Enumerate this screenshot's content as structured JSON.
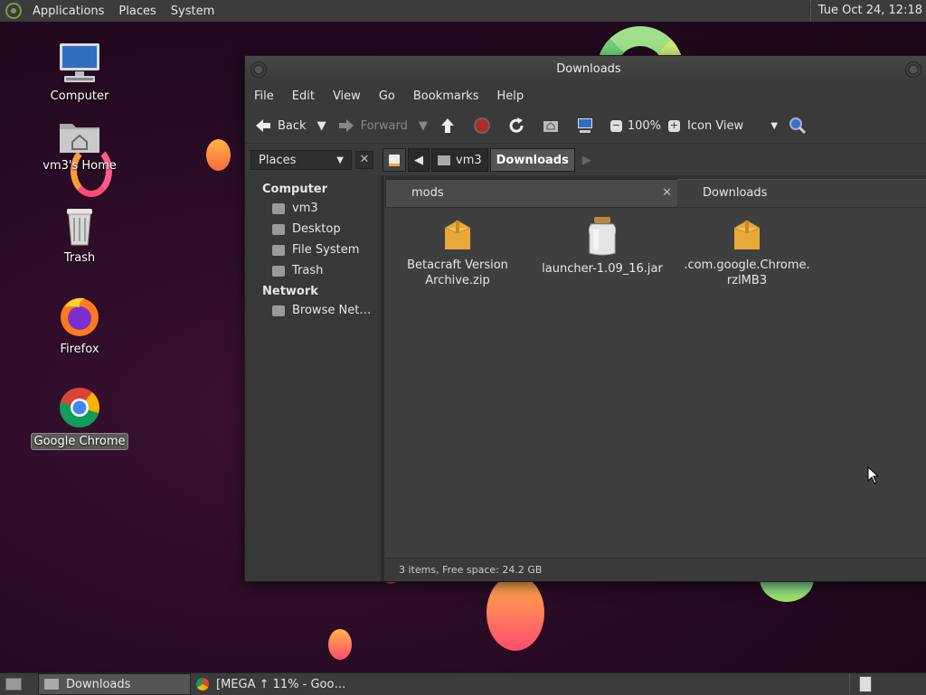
{
  "top_panel": {
    "menus": [
      "Applications",
      "Places",
      "System"
    ],
    "clock": "Tue Oct 24, 12:18"
  },
  "desktop": {
    "icons": [
      {
        "label": "Computer",
        "icon": "computer-icon"
      },
      {
        "label": "vm3's Home",
        "icon": "home-folder-icon"
      },
      {
        "label": "Trash",
        "icon": "trash-icon"
      },
      {
        "label": "Firefox",
        "icon": "firefox-icon"
      },
      {
        "label": "Google Chrome",
        "icon": "chrome-icon",
        "selected": true
      }
    ]
  },
  "window": {
    "title": "Downloads",
    "menubar": [
      "File",
      "Edit",
      "View",
      "Go",
      "Bookmarks",
      "Help"
    ],
    "toolbar": {
      "back": "Back",
      "forward": "Forward",
      "zoom": "100%",
      "view_mode": "Icon View"
    },
    "location": {
      "places_label": "Places",
      "breadcrumbs": [
        "vm3",
        "Downloads"
      ]
    },
    "sidebar": {
      "sections": [
        {
          "heading": "Computer",
          "items": [
            "vm3",
            "Desktop",
            "File System",
            "Trash"
          ]
        },
        {
          "heading": "Network",
          "items": [
            "Browse Net…"
          ]
        }
      ]
    },
    "tabs": [
      {
        "label": "mods",
        "active": false
      },
      {
        "label": "Downloads",
        "active": true
      }
    ],
    "files": [
      {
        "name_line1": "Betacraft Version",
        "name_line2": "Archive.zip",
        "icon": "archive-icon"
      },
      {
        "name_line1": "launcher-1.09_16.jar",
        "name_line2": "",
        "icon": "jar-icon"
      },
      {
        "name_line1": ".com.google.Chrome.",
        "name_line2": "rzlMB3",
        "icon": "archive-icon"
      }
    ],
    "status": "3 items, Free space: 24.2 GB"
  },
  "taskbar": {
    "tasks": [
      {
        "label": "Downloads",
        "active": true
      },
      {
        "label": "[MEGA ↑ 11% - Goo…",
        "active": false
      }
    ]
  },
  "colors": {
    "panel": "#3c3c3c",
    "window": "#3a3a3a",
    "desktop": "#2a0d25",
    "folder": "#e8a93a"
  }
}
